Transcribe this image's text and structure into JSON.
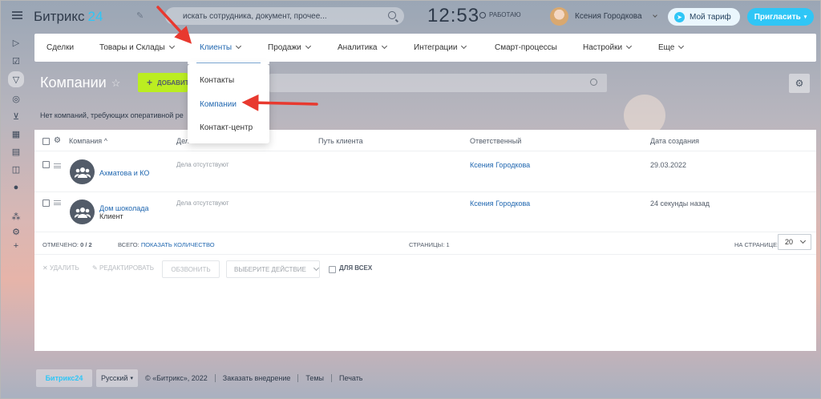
{
  "header": {
    "logo_text": "Битрикс",
    "logo_suffix": "24",
    "search_placeholder": "искать сотрудника, документ, прочее...",
    "clock": "12:53",
    "work_status": "РАБОТАЮ",
    "user_name": "Ксения Городкова",
    "tariff_label": "Мой тариф",
    "invite_label": "Пригласить"
  },
  "topnav": {
    "items": [
      {
        "label": "Сделки"
      },
      {
        "label": "Товары и Склады"
      },
      {
        "label": "Клиенты"
      },
      {
        "label": "Продажи"
      },
      {
        "label": "Аналитика"
      },
      {
        "label": "Интеграции"
      },
      {
        "label": "Смарт-процессы"
      },
      {
        "label": "Настройки"
      },
      {
        "label": "Еще"
      }
    ]
  },
  "dropdown": {
    "items": [
      {
        "label": "Контакты"
      },
      {
        "label": "Компании"
      },
      {
        "label": "Контакт-центр"
      }
    ]
  },
  "page": {
    "title": "Компании",
    "add_label": "ДОБАВИТЬ",
    "notice": "Нет компаний, требующих оперативной ре"
  },
  "grid": {
    "columns": [
      "Компания",
      "Дела",
      "Путь клиента",
      "Ответственный",
      "Дата создания"
    ],
    "rows": [
      {
        "name": "Ахматова и КО",
        "type": "",
        "deals": "Дела отсутствуют",
        "responsible": "Ксения Городкова",
        "created": "29.03.2022"
      },
      {
        "name": "Дом шоколада",
        "type": "Клиент",
        "deals": "Дела отсутствуют",
        "responsible": "Ксения Городкова",
        "created": "24 секунды назад"
      }
    ],
    "footer": {
      "selected_label": "ОТМЕЧЕНО:",
      "selected_value": "0 / 2",
      "total_label": "ВСЕГО:",
      "total_link": "ПОКАЗАТЬ КОЛИЧЕСТВО",
      "pages_label": "СТРАНИЦЫ:",
      "pages_value": "1",
      "per_page_label": "НА СТРАНИЦЕ:",
      "per_page_value": "20"
    },
    "actions": {
      "delete": "УДАЛИТЬ",
      "edit": "РЕДАКТИРОВАТЬ",
      "call": "ОБЗВОНИТЬ",
      "choose": "ВЫБЕРИТЕ ДЕЙСТВИЕ",
      "for_all": "ДЛЯ ВСЕХ"
    }
  },
  "footer": {
    "logo": "Битрикс24",
    "language": "Русский",
    "copyright": "© «Битрикс», 2022",
    "order": "Заказать внедрение",
    "themes": "Темы",
    "print": "Печать"
  },
  "colors": {
    "accent": "#2fc6f6",
    "link": "#2067b0",
    "add_button": "#bbed21",
    "arrow": "#e8392f"
  }
}
